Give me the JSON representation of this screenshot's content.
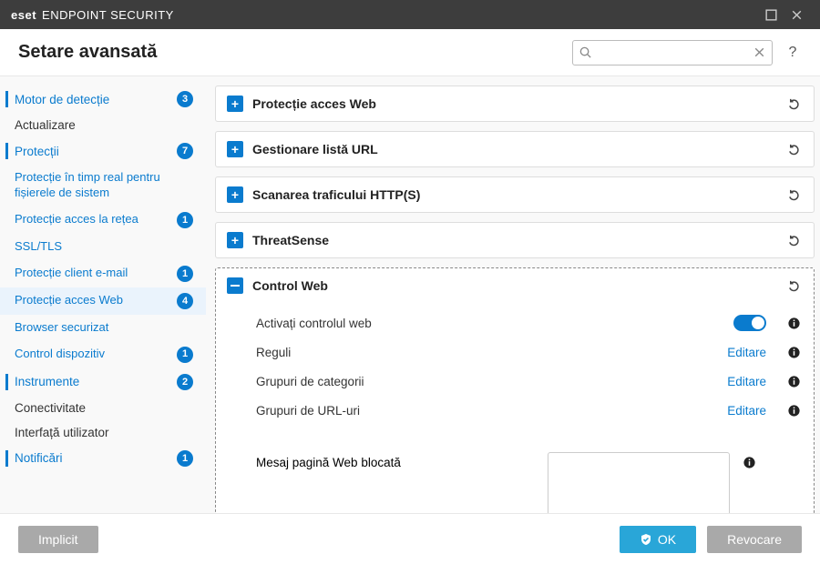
{
  "titlebar": {
    "brand": "eset",
    "product": "ENDPOINT SECURITY"
  },
  "header": {
    "title": "Setare avansată",
    "search_placeholder": ""
  },
  "sidebar": {
    "items": [
      {
        "label": "Motor de detecție",
        "badge": "3",
        "link": true,
        "active": true
      },
      {
        "label": "Actualizare",
        "link": false
      },
      {
        "label": "Protecții",
        "badge": "7",
        "link": true,
        "active": true
      },
      {
        "label": "Instrumente",
        "badge": "2",
        "link": true,
        "active": true
      },
      {
        "label": "Conectivitate",
        "link": false
      },
      {
        "label": "Interfață utilizator",
        "link": false
      },
      {
        "label": "Notificări",
        "badge": "1",
        "link": true,
        "active": true
      }
    ],
    "protections_sub": [
      {
        "label": "Protecție în timp real pentru fișierele de sistem"
      },
      {
        "label": "Protecție acces la rețea",
        "badge": "1"
      },
      {
        "label": "SSL/TLS"
      },
      {
        "label": "Protecție client e-mail",
        "badge": "1"
      },
      {
        "label": "Protecție acces Web",
        "badge": "4",
        "selected": true
      },
      {
        "label": "Browser securizat"
      },
      {
        "label": "Control dispozitiv",
        "badge": "1"
      }
    ]
  },
  "panels": [
    {
      "title": "Protecție acces Web"
    },
    {
      "title": "Gestionare listă URL"
    },
    {
      "title": "Scanarea traficului HTTP(S)"
    },
    {
      "title": "ThreatSense"
    }
  ],
  "control_web": {
    "title": "Control Web",
    "rows": {
      "enable": "Activați controlul web",
      "rules": "Reguli",
      "cat_groups": "Grupuri de categorii",
      "url_groups": "Grupuri de URL-uri",
      "edit": "Editare",
      "blocked_msg": "Mesaj pagină Web blocată"
    }
  },
  "footer": {
    "default": "Implicit",
    "ok": "OK",
    "cancel": "Revocare"
  }
}
